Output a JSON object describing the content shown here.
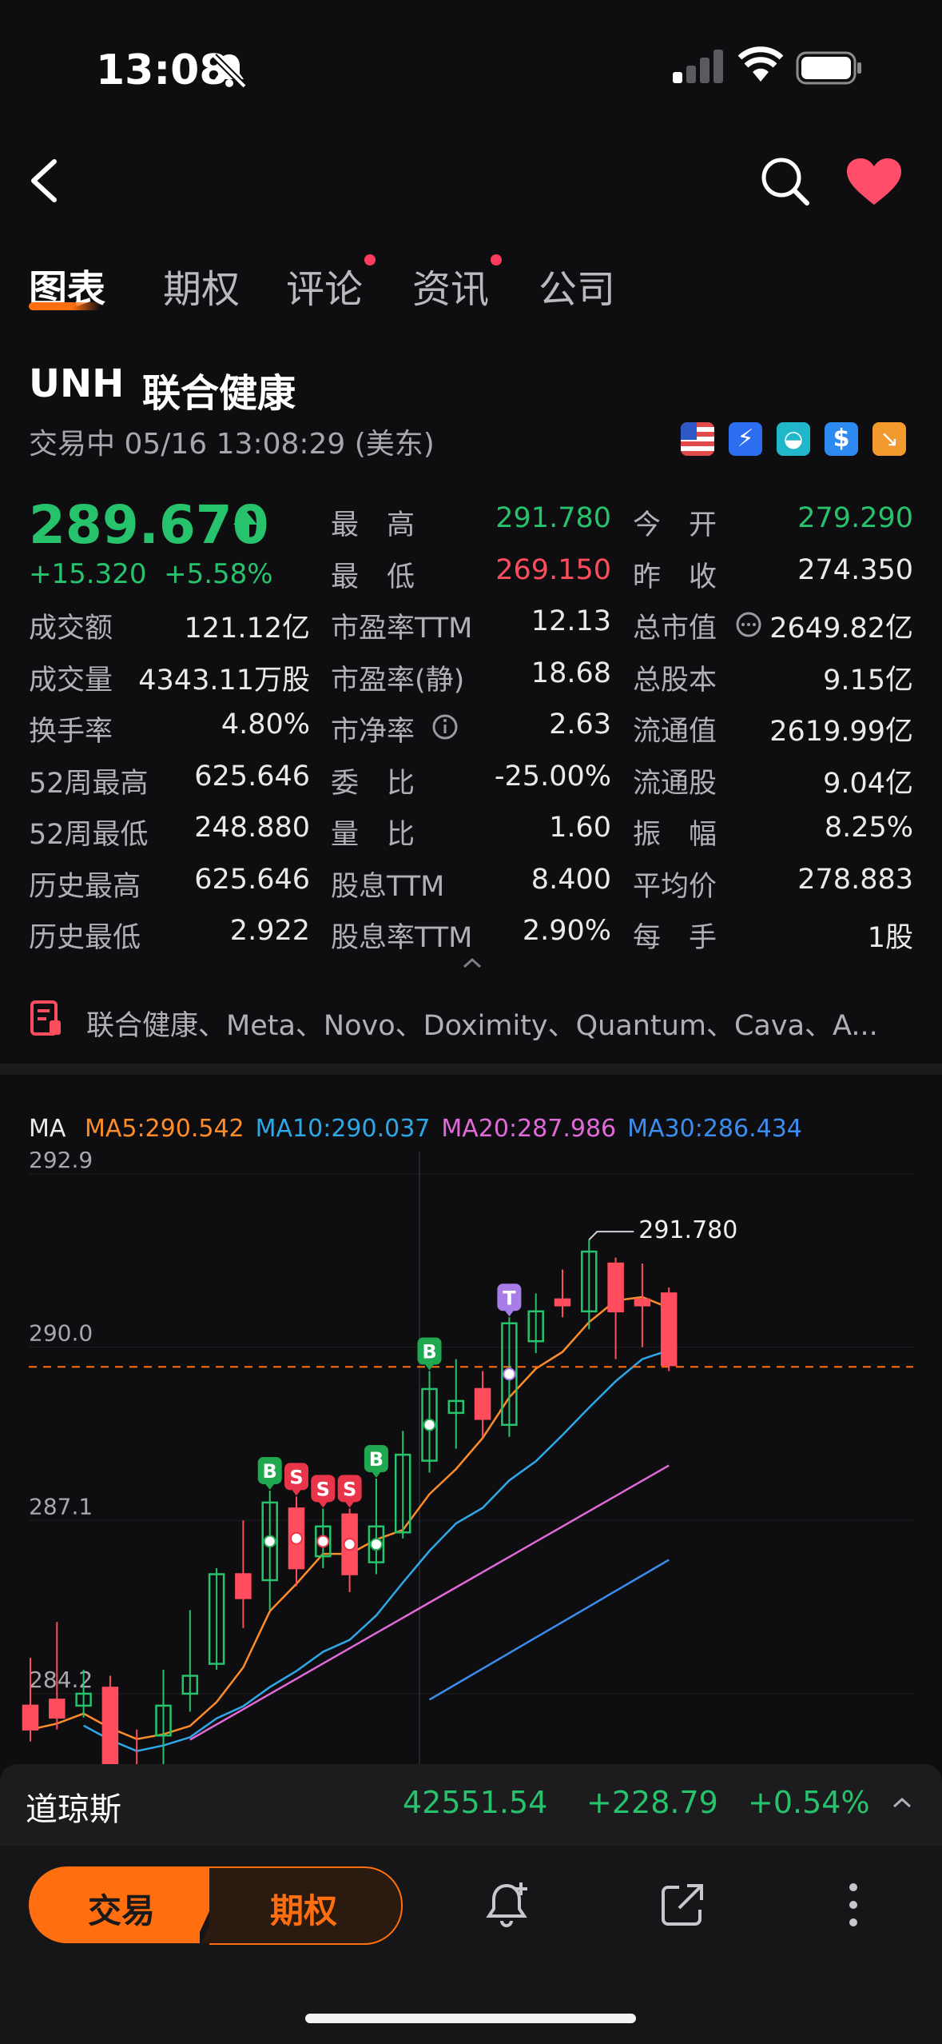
{
  "status_bar": {
    "time": "13:08"
  },
  "nav": {
    "tabs": [
      "图表",
      "期权",
      "评论",
      "资讯",
      "公司"
    ],
    "active_tab": 0,
    "tabs_with_dot": [
      2,
      3
    ]
  },
  "header": {
    "ticker": "UNH",
    "name": "联合健康",
    "session": "交易中 05/16 13:08:29 (美东)",
    "price": "289.670",
    "change": "+15.320",
    "change_pct": "+5.58%"
  },
  "quote_rows": [
    {
      "k1": "最　高",
      "v1": "291.780",
      "c1": "green",
      "k2": "今　开",
      "v2": "279.290",
      "c2": "green"
    },
    {
      "k1": "最　低",
      "v1": "269.150",
      "c1": "red",
      "k2": "昨　收",
      "v2": "274.350",
      "c2": ""
    },
    {
      "k0": "成交额",
      "v0": "121.12亿",
      "k1": "市盈率TTM",
      "v1": "12.13",
      "k2": "总市值",
      "v2": "2649.82亿"
    },
    {
      "k0": "成交量",
      "v0": "4343.11万股",
      "k1": "市盈率(静)",
      "v1": "18.68",
      "k2": "总股本",
      "v2": "9.15亿"
    },
    {
      "k0": "换手率",
      "v0": "4.80%",
      "k1": "市净率",
      "v1": "2.63",
      "k2": "流通值",
      "v2": "2619.99亿"
    },
    {
      "k0": "52周最高",
      "v0": "625.646",
      "k1": "委　比",
      "v1": "-25.00%",
      "k2": "流通股",
      "v2": "9.04亿"
    },
    {
      "k0": "52周最低",
      "v0": "248.880",
      "k1": "量　比",
      "v1": "1.60",
      "k2": "振　幅",
      "v2": "8.25%"
    },
    {
      "k0": "历史最高",
      "v0": "625.646",
      "k1": "股息TTM",
      "v1": "8.400",
      "k2": "平均价",
      "v2": "278.883"
    },
    {
      "k0": "历史最低",
      "v0": "2.922",
      "k1": "股息率TTM",
      "v1": "2.90%",
      "k2": "每　手",
      "v2": "1股"
    }
  ],
  "related": "联合健康、Meta、Novo、Doximity、Quantum、Cava、A...",
  "chart_data": {
    "type": "candlestick",
    "indicator_label": "MA",
    "ma": [
      {
        "name": "MA5",
        "value": "290.542",
        "color": "#ff8c2a"
      },
      {
        "name": "MA10",
        "value": "290.037",
        "color": "#2fa8e8"
      },
      {
        "name": "MA20",
        "value": "287.986",
        "color": "#e06ad8"
      },
      {
        "name": "MA30",
        "value": "286.434",
        "color": "#3b8df0"
      }
    ],
    "y_ticks": [
      "292.9",
      "290.0",
      "287.1",
      "284.2"
    ],
    "high_annotation": "291.780",
    "last_price_line": 289.67,
    "candles": [
      {
        "o": 284.0,
        "c": 283.6,
        "h": 284.8,
        "l": 283.4
      },
      {
        "o": 284.1,
        "c": 283.8,
        "h": 285.4,
        "l": 283.6
      },
      {
        "o": 284.0,
        "c": 284.2,
        "h": 284.6,
        "l": 283.8
      },
      {
        "o": 284.3,
        "c": 282.9,
        "h": 284.5,
        "l": 282.7
      },
      {
        "o": 282.8,
        "c": 282.7,
        "h": 283.6,
        "l": 282.5
      },
      {
        "o": 283.5,
        "c": 284.0,
        "h": 284.6,
        "l": 283.0
      },
      {
        "o": 284.2,
        "c": 284.5,
        "h": 285.6,
        "l": 283.9
      },
      {
        "o": 284.7,
        "c": 286.2,
        "h": 286.3,
        "l": 284.6
      },
      {
        "o": 286.2,
        "c": 285.8,
        "h": 287.1,
        "l": 285.3
      },
      {
        "o": 286.1,
        "c": 287.4,
        "h": 287.6,
        "l": 285.6
      },
      {
        "o": 287.3,
        "c": 286.3,
        "h": 287.5,
        "l": 286.0
      },
      {
        "o": 286.5,
        "c": 287.0,
        "h": 287.3,
        "l": 286.3
      },
      {
        "o": 287.2,
        "c": 286.2,
        "h": 287.3,
        "l": 285.9
      },
      {
        "o": 286.4,
        "c": 287.0,
        "h": 287.8,
        "l": 286.2
      },
      {
        "o": 286.9,
        "c": 288.2,
        "h": 288.6,
        "l": 286.8
      },
      {
        "o": 288.1,
        "c": 289.3,
        "h": 289.6,
        "l": 287.9
      },
      {
        "o": 288.9,
        "c": 289.1,
        "h": 289.8,
        "l": 288.3
      },
      {
        "o": 289.3,
        "c": 288.8,
        "h": 289.6,
        "l": 288.5
      },
      {
        "o": 288.7,
        "c": 290.4,
        "h": 290.5,
        "l": 288.5
      },
      {
        "o": 290.1,
        "c": 290.6,
        "h": 290.9,
        "l": 289.9
      },
      {
        "o": 290.8,
        "c": 290.7,
        "h": 291.3,
        "l": 290.5
      },
      {
        "o": 290.6,
        "c": 291.6,
        "h": 291.8,
        "l": 290.3
      },
      {
        "o": 291.4,
        "c": 290.6,
        "h": 291.5,
        "l": 289.8
      },
      {
        "o": 290.8,
        "c": 290.7,
        "h": 291.4,
        "l": 290.0
      },
      {
        "o": 290.9,
        "c": 289.7,
        "h": 291.0,
        "l": 289.6
      }
    ],
    "markers": [
      {
        "i": 9,
        "label": "B",
        "color": "#1fa84f"
      },
      {
        "i": 10,
        "label": "S",
        "color": "#e8354a"
      },
      {
        "i": 11,
        "label": "S",
        "color": "#e8354a"
      },
      {
        "i": 12,
        "label": "S",
        "color": "#e8354a"
      },
      {
        "i": 13,
        "label": "B",
        "color": "#1fa84f"
      },
      {
        "i": 15,
        "label": "B",
        "color": "#1fa84f"
      },
      {
        "i": 18,
        "label": "T",
        "color": "#a77ee8"
      }
    ]
  },
  "index_bar": {
    "name": "道琼斯",
    "value": "42551.54",
    "change": "+228.79",
    "change_pct": "+0.54%"
  },
  "bottom_nav": {
    "trade": "交易",
    "options": "期权"
  },
  "colors": {
    "up": "#27c26c",
    "down": "#ff4d5e",
    "accent": "#ff6f0f"
  }
}
